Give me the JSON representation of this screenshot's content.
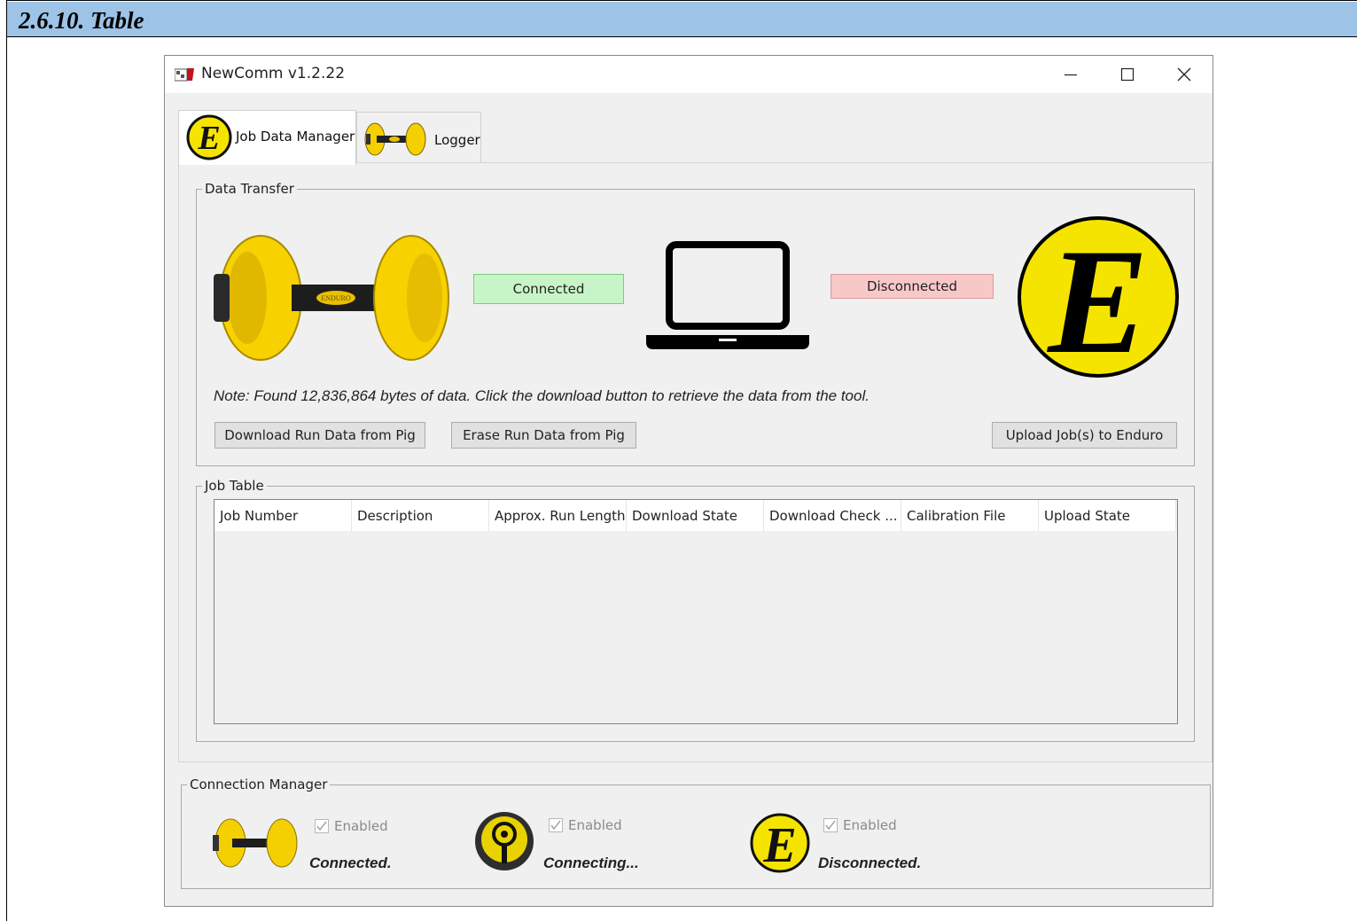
{
  "document": {
    "section_heading": "2.6.10. Table"
  },
  "window": {
    "title": "NewComm v1.2.22",
    "controls": {
      "minimize": "—",
      "maximize": "☐",
      "close": "✕"
    }
  },
  "tabs": [
    {
      "label": "Job Data Manager",
      "active": true
    },
    {
      "label": "Logger",
      "active": false
    }
  ],
  "data_transfer": {
    "group_label": "Data Transfer",
    "pig_status": "Connected",
    "enduro_status": "Disconnected",
    "logo_letter": "E",
    "note": "Note:  Found 12,836,864 bytes of data. Click the download button to retrieve the data from the tool.",
    "buttons": {
      "download": "Download Run Data from Pig",
      "erase": "Erase Run Data from Pig",
      "upload": "Upload Job(s) to Enduro"
    }
  },
  "job_table": {
    "group_label": "Job Table",
    "columns": [
      "Job Number",
      "Description",
      "Approx. Run Length",
      "Download State",
      "Download Check ...",
      "Calibration File",
      "Upload State"
    ],
    "rows": []
  },
  "connection_manager": {
    "group_label": "Connection Manager",
    "items": [
      {
        "device": "pig-tool",
        "enabled_label": "Enabled",
        "status": "Connected."
      },
      {
        "device": "logger",
        "enabled_label": "Enabled",
        "status": "Connecting..."
      },
      {
        "device": "enduro",
        "enabled_label": "Enabled",
        "status": "Disconnected."
      }
    ]
  },
  "colors": {
    "section_bar": "#9dc3e6",
    "connected_bg": "#c8f5c8",
    "disconnected_bg": "#f8c8c8",
    "brand_yellow": "#f5e400"
  }
}
